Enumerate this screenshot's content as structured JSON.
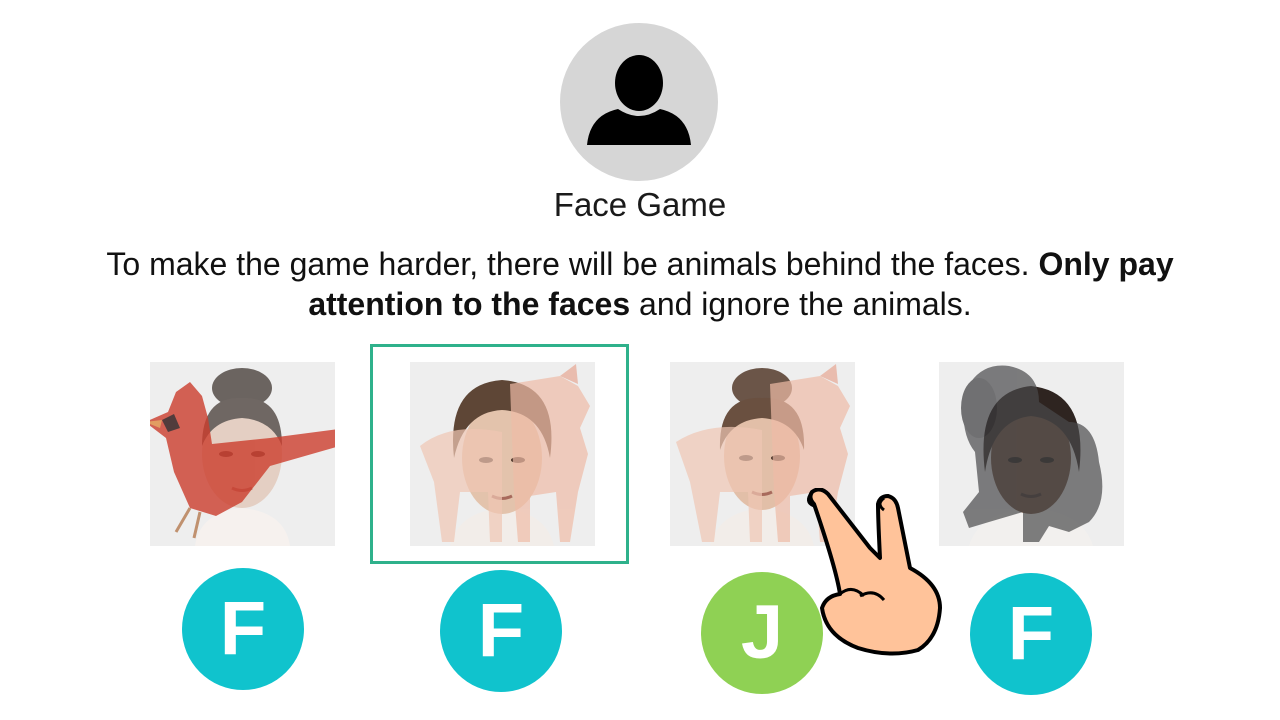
{
  "game": {
    "title": "Face Game",
    "instruction_part1": "To make the game harder, there will be animals behind the faces. ",
    "instruction_bold": "Only pay attention to the faces",
    "instruction_part2": " and ignore the animals."
  },
  "trials": [
    {
      "animal": "cardinal",
      "key": "F",
      "key_color": "#10c3cd",
      "selected": false
    },
    {
      "animal": "pig",
      "key": "F",
      "key_color": "#10c3cd",
      "selected": true
    },
    {
      "animal": "pig",
      "key": "J",
      "key_color": "#8fd154",
      "selected": false
    },
    {
      "animal": "dog",
      "key": "F",
      "key_color": "#10c3cd",
      "selected": false
    }
  ],
  "icons": {
    "avatar": "person-icon",
    "pointer": "pointing-hand-icon"
  },
  "colors": {
    "highlight": "#2fb18b",
    "key_f": "#10c3cd",
    "key_j": "#8fd154"
  }
}
